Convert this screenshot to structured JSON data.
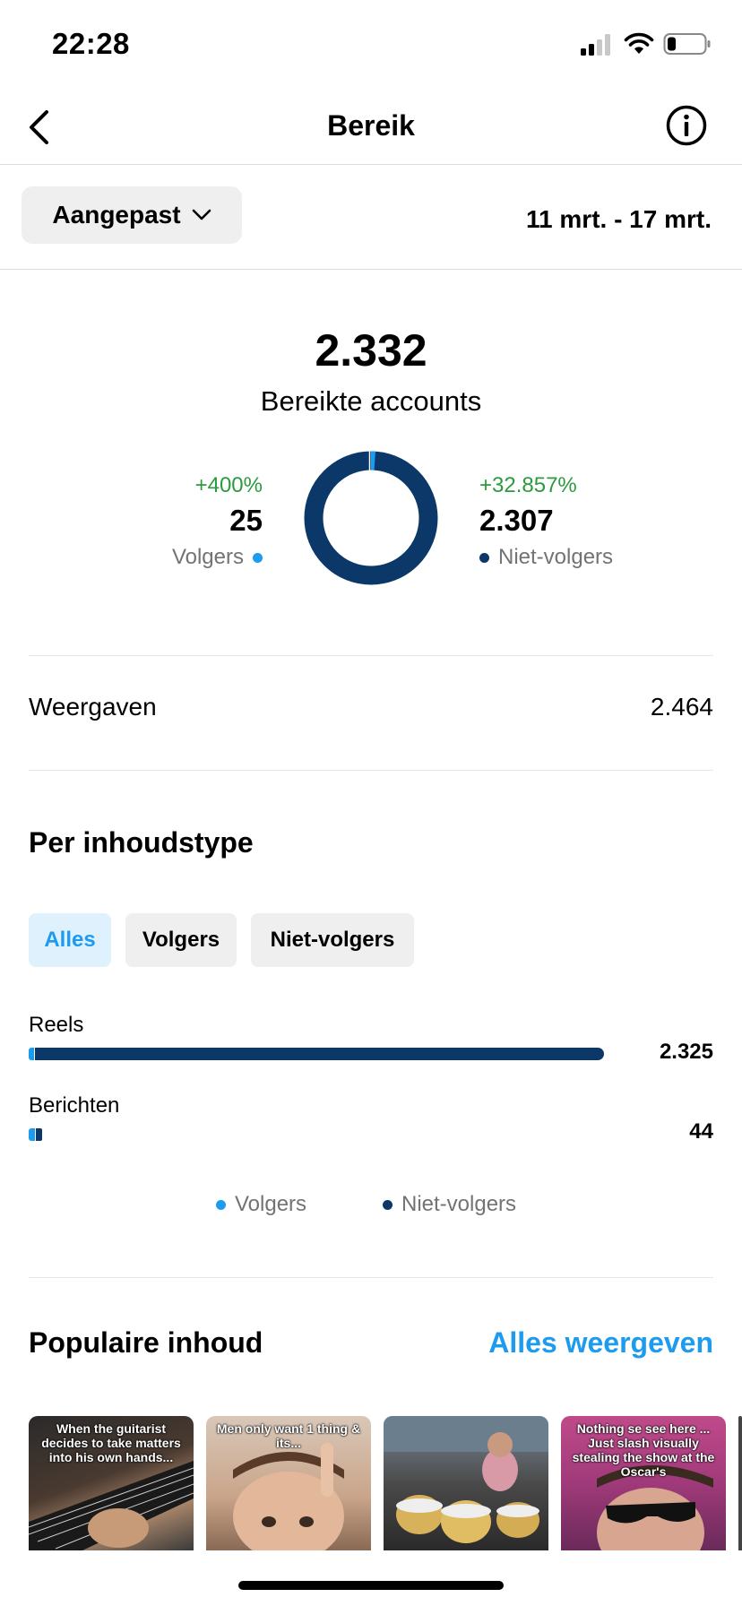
{
  "status": {
    "time": "22:28"
  },
  "header": {
    "title": "Bereik"
  },
  "filter": {
    "label": "Aangepast",
    "date_range": "11 mrt. - 17 mrt."
  },
  "summary": {
    "total": "2.332",
    "total_label": "Bereikte accounts",
    "followers": {
      "change": "+400%",
      "value": "25",
      "label": "Volgers"
    },
    "non_followers": {
      "change": "+32.857%",
      "value": "2.307",
      "label": "Niet-volgers"
    },
    "follower_share": 0.0107
  },
  "views": {
    "label": "Weergaven",
    "value": "2.464"
  },
  "content_type": {
    "title": "Per inhoudstype",
    "chips": [
      "Alles",
      "Volgers",
      "Niet-volgers"
    ],
    "rows": [
      {
        "label": "Reels",
        "value": "2.325"
      },
      {
        "label": "Berichten",
        "value": "44"
      }
    ],
    "legend": {
      "followers": "Volgers",
      "non_followers": "Niet-volgers"
    }
  },
  "popular": {
    "title": "Populaire inhoud",
    "link": "Alles weergeven",
    "thumbs": [
      {
        "caption": "When the guitarist decides to take matters into his own hands..."
      },
      {
        "caption": "Men only want 1 thing & its..."
      },
      {
        "caption": ""
      },
      {
        "caption": "Nothing se see here ... Just slash visually stealing the show at the Oscar's"
      }
    ]
  },
  "colors": {
    "followers": "#1c9bef",
    "non_followers": "#0b3868",
    "positive": "#2c9a3e",
    "link": "#1c9bef"
  }
}
